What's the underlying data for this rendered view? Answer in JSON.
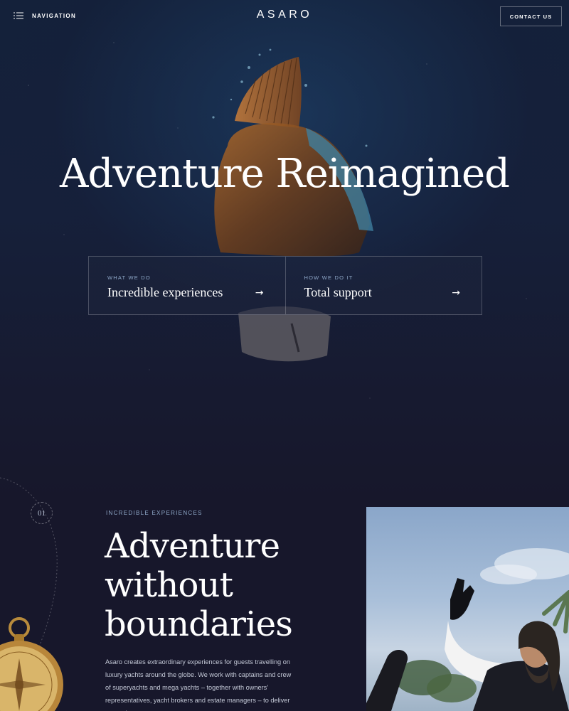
{
  "header": {
    "nav_label": "NAVIGATION",
    "logo": "ASARO",
    "contact_label": "CONTACT US"
  },
  "hero": {
    "title": "Adventure Reimagined",
    "cards": [
      {
        "kicker": "WHAT WE DO",
        "title": "Incredible experiences",
        "arrow": "→"
      },
      {
        "kicker": "HOW WE DO IT",
        "title": "Total support",
        "arrow": "→"
      }
    ]
  },
  "section": {
    "number": "01",
    "kicker": "INCREDIBLE EXPERIENCES",
    "headline_lines": [
      "Adventure",
      "without",
      "boundaries"
    ],
    "body": "Asaro creates extraordinary experiences for guests travelling on luxury yachts around the globe. We work with captains and crew of superyachts and mega yachts – together with owners’ representatives, yacht brokers and estate managers – to deliver entertainment on a"
  },
  "icons": {
    "nav": "menu-lines-icon",
    "arrow": "arrow-right-icon"
  },
  "colors": {
    "background": "#17172b",
    "accent_text": "#8fa8c8"
  }
}
